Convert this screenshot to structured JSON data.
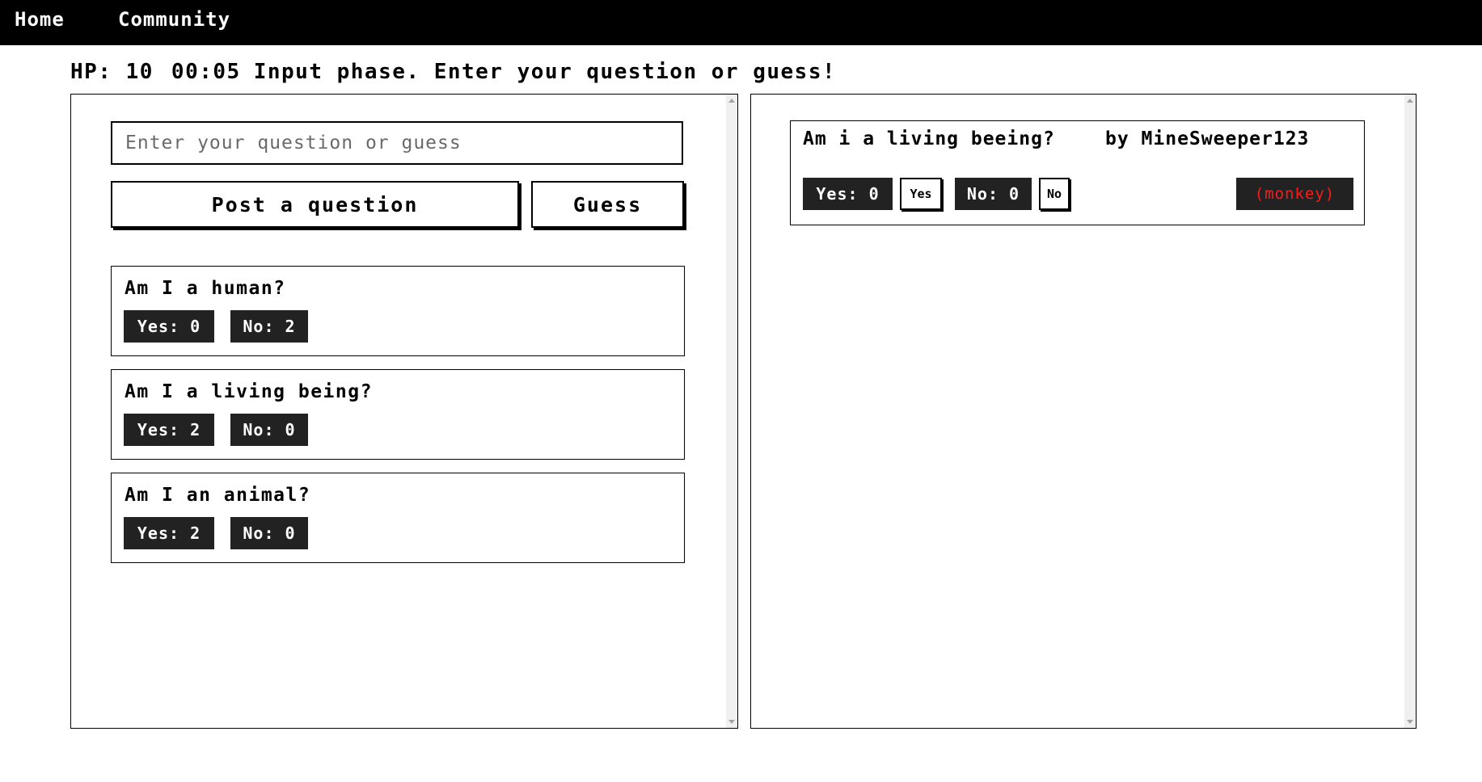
{
  "nav": {
    "home": "Home",
    "community": "Community"
  },
  "status": {
    "hp": "HP: 10",
    "timer": "00:05",
    "phase": "Input phase. Enter your question or guess!"
  },
  "input": {
    "placeholder": "Enter your question or guess",
    "value": ""
  },
  "buttons": {
    "post": "Post a question",
    "guess": "Guess"
  },
  "questions": [
    {
      "text": "Am I a human?",
      "yes": "Yes: 0",
      "no": "No: 2"
    },
    {
      "text": "Am I a living being?",
      "yes": "Yes: 2",
      "no": "No: 0"
    },
    {
      "text": "Am I an animal?",
      "yes": "Yes: 2",
      "no": "No: 0"
    }
  ],
  "community_questions": [
    {
      "text": "Am i a living beeing?",
      "author": "by MineSweeper123",
      "yes_count": "Yes: 0",
      "yes_button": "Yes",
      "no_count": "No: 0",
      "no_button": "No",
      "answer": "(monkey)",
      "answer_color": "#ff1a1a"
    }
  ],
  "colors": {
    "topbar": "#000000",
    "badge": "#222222",
    "answer_text": "#ff1a1a"
  }
}
